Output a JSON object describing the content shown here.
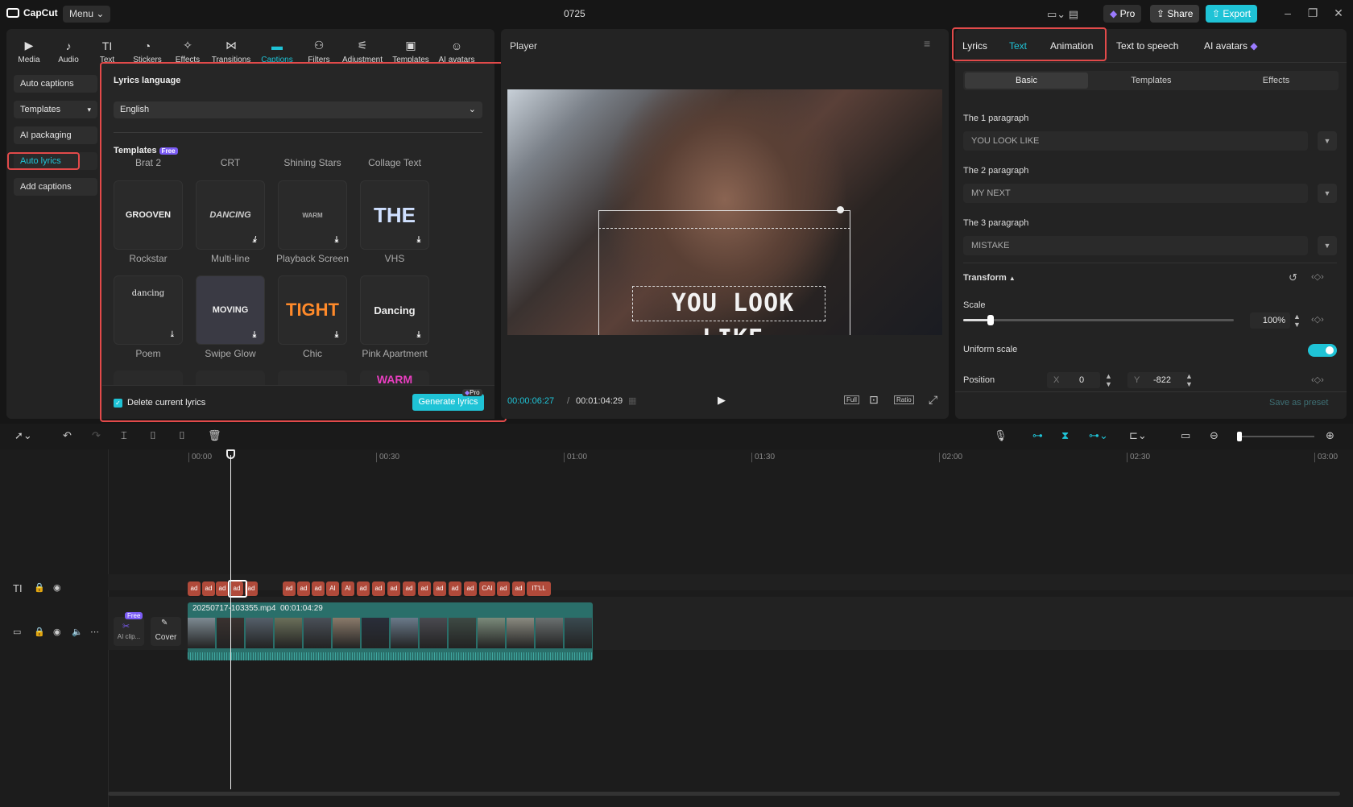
{
  "app": {
    "logo_text": "CapCut",
    "menu_label": "Menu",
    "project_name": "0725",
    "pro_label": "Pro",
    "share_label": "Share",
    "export_label": "Export"
  },
  "media_toolbar": {
    "tabs": [
      {
        "label": "Media",
        "icon": "media-icon"
      },
      {
        "label": "Audio",
        "icon": "audio-icon"
      },
      {
        "label": "Text",
        "icon": "text-icon"
      },
      {
        "label": "Stickers",
        "icon": "stickers-icon"
      },
      {
        "label": "Effects",
        "icon": "effects-icon"
      },
      {
        "label": "Transitions",
        "icon": "transitions-icon"
      },
      {
        "label": "Captions",
        "icon": "captions-icon",
        "active": true
      },
      {
        "label": "Filters",
        "icon": "filters-icon"
      },
      {
        "label": "Adjustment",
        "icon": "adjustment-icon"
      },
      {
        "label": "Templates",
        "icon": "templates-icon"
      },
      {
        "label": "AI avatars",
        "icon": "ai-avatars-icon"
      }
    ]
  },
  "captions_sidebar": {
    "items": [
      "Auto captions",
      "Templates",
      "AI packaging",
      "Auto lyrics",
      "Add captions"
    ],
    "active": "Auto lyrics"
  },
  "lyrics_panel": {
    "language_label": "Lyrics language",
    "language_value": "English",
    "templates_label": "Templates",
    "free_badge": "Free",
    "header_names": [
      "Brat 2",
      "CRT",
      "Shining Stars",
      "Collage Text"
    ],
    "row1": [
      {
        "name": "Rockstar",
        "preview": "GROOVEN"
      },
      {
        "name": "Multi-line",
        "preview": "DANCING"
      },
      {
        "name": "Playback Screen",
        "preview": "WARM"
      },
      {
        "name": "VHS",
        "preview": "THE"
      }
    ],
    "row2": [
      {
        "name": "Poem",
        "preview": "dancing"
      },
      {
        "name": "Swipe Glow",
        "preview": "MOVING"
      },
      {
        "name": "Chic",
        "preview": "TIGHT"
      },
      {
        "name": "Pink Apartment",
        "preview": "Dancing"
      }
    ],
    "row3_preview": "WARM",
    "delete_label": "Delete current lyrics",
    "generate_label": "Generate lyrics",
    "pro_badge": "Pro"
  },
  "player": {
    "title": "Player",
    "overlay_text": "YOU LOOK LIKE",
    "current_time": "00:00:06:27",
    "total_time": "00:01:04:29",
    "full_label": "Full",
    "ratio_label": "Ratio"
  },
  "inspector": {
    "tabs": [
      "Lyrics",
      "Text",
      "Animation",
      "Text to speech",
      "AI avatars"
    ],
    "active_tab": "Text",
    "subtabs": [
      "Basic",
      "Templates",
      "Effects"
    ],
    "active_subtab": "Basic",
    "paragraphs": [
      {
        "label": "The 1 paragraph",
        "value": "YOU LOOK LIKE"
      },
      {
        "label": "The 2 paragraph",
        "value": "MY NEXT"
      },
      {
        "label": "The 3 paragraph",
        "value": "MISTAKE"
      }
    ],
    "transform_label": "Transform",
    "scale_label": "Scale",
    "scale_value": "100%",
    "scale_level": 0.1,
    "uniform_scale_label": "Uniform scale",
    "uniform_scale_on": true,
    "position_label": "Position",
    "x_label": "X",
    "x_value": "0",
    "y_label": "Y",
    "y_value": "-822",
    "save_preset_label": "Save as preset"
  },
  "timeline": {
    "ruler": [
      "00:00",
      "00:30",
      "01:00",
      "01:30",
      "02:00",
      "02:30",
      "03:00"
    ],
    "caption_chips": [
      "ad",
      "ad",
      "ad",
      "ad",
      "ad",
      "ad",
      "ad",
      "ad",
      "AI",
      "AI",
      "ad",
      "ad",
      "ad",
      "ad",
      "ad",
      "ad",
      "ad",
      "ad",
      "CAI",
      "ad",
      "ad",
      "IT'LL"
    ],
    "clip_name": "20250717-103355.mp4",
    "clip_duration": "00:01:04:29",
    "free_badge": "Free",
    "ai_clip_label": "AI clip...",
    "cover_label": "Cover"
  },
  "colors": {
    "accent": "#1fc3d6",
    "highlight": "#e24a4a",
    "pro": "#7b5cf5",
    "caption_chip": "#b04a3a",
    "clip": "#2a6f6a"
  }
}
